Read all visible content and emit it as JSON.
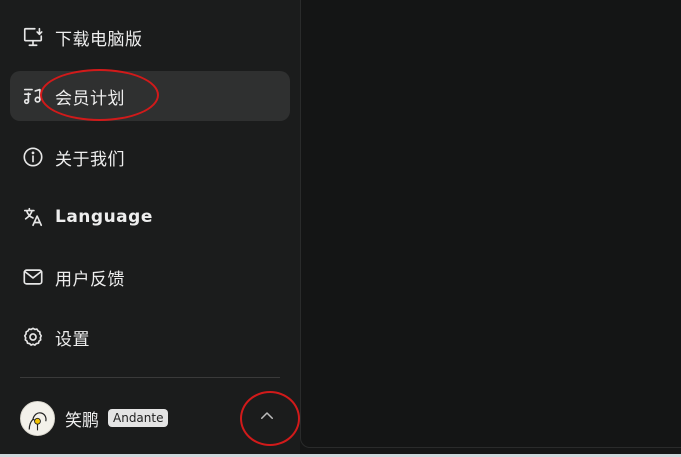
{
  "sidebar": {
    "items": [
      {
        "label": "下载电脑版",
        "icon": "desktop-download-icon"
      },
      {
        "label": "会员计划",
        "icon": "music-note-icon",
        "active": true
      },
      {
        "label": "关于我们",
        "icon": "info-icon"
      },
      {
        "label": "Language",
        "icon": "translate-icon"
      },
      {
        "label": "用户反馈",
        "icon": "mail-icon"
      },
      {
        "label": "设置",
        "icon": "gear-icon"
      }
    ]
  },
  "user": {
    "name": "笑鹏",
    "plan": "Andante"
  },
  "colors": {
    "sidebar_bg": "#1b1c1c",
    "active_item_bg": "#2f3030",
    "main_bg": "#141515",
    "annotation": "#d11a1a"
  }
}
